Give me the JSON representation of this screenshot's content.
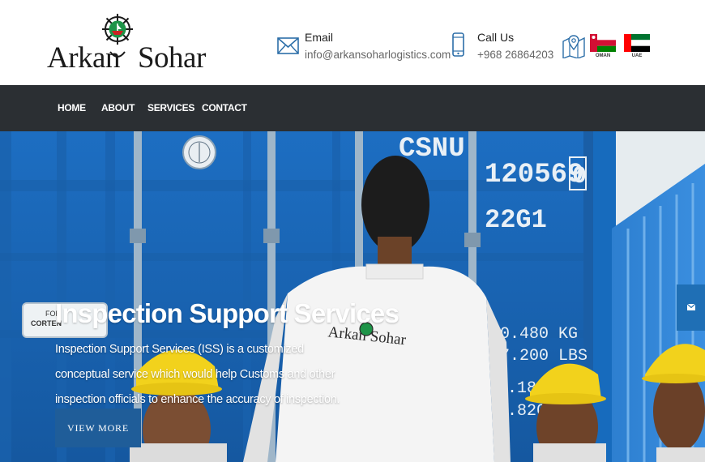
{
  "header": {
    "logo": {
      "text_left": "Arkan",
      "text_right": "Sohar",
      "icon": "ship-wheel-logo-icon"
    },
    "email": {
      "label": "Email",
      "value": "info@arkansoharlogistics.com",
      "icon": "envelope-icon"
    },
    "phone": {
      "label": "Call Us",
      "value": "+968 26864203",
      "icon": "mobile-phone-icon"
    },
    "locations": [
      {
        "country": "OMAN",
        "icon": "oman-flag-icon"
      },
      {
        "country": "UAE",
        "icon": "uae-flag-icon"
      }
    ],
    "location_icon": "map-pin-icon"
  },
  "nav": {
    "items": [
      {
        "label": "HOME"
      },
      {
        "label": "ABOUT"
      },
      {
        "label": "SERVICES"
      },
      {
        "label": "CONTACT"
      }
    ]
  },
  "hero": {
    "title": "Inspection Support Services",
    "description": "Inspection Support Services (ISS) is a customized conceptual service which would help Customs and other inspection officials to enhance the accuracy of inspection.",
    "button_label": "VIEW MORE",
    "background_text": {
      "container_code": "CSNU",
      "container_number": "120569",
      "check_digit": "0",
      "type_code": "22G1",
      "max_gross_kg": "30.480 KG",
      "max_gross_lbs": "67.200 LBS",
      "tare_1": "2.185",
      "tare_2": "4.820",
      "plate_line_1": "FOR",
      "plate_line_2": "CORTEN",
      "shirt_logo": "Arkan Sohar"
    },
    "side_contact_icon": "envelope-icon"
  },
  "colors": {
    "nav_bg": "#2b2f33",
    "container_blue": "#1f6bb8",
    "button_blue": "#1f5d99",
    "helmet_yellow": "#f2d21c",
    "oman_red": "#d21034",
    "oman_green": "#008000",
    "uae_green": "#00732f",
    "uae_red": "#ff0000"
  }
}
